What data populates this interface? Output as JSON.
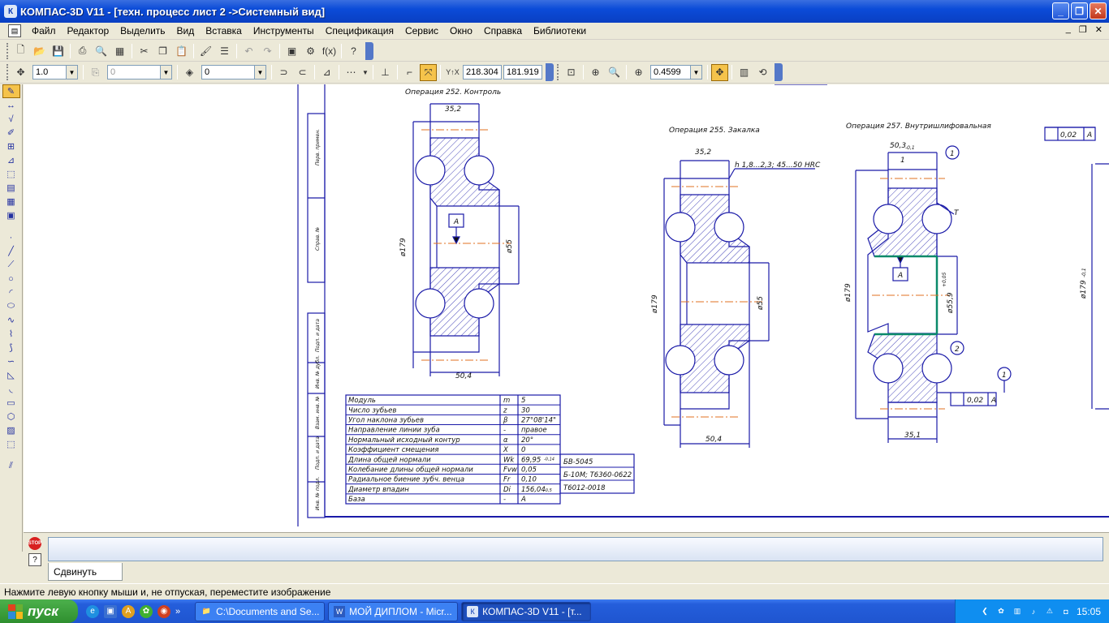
{
  "window": {
    "title": "КОМПАС-3D V11 - [техн. процесс лист 2 ->Системный вид]",
    "app_icon": "К"
  },
  "menu": [
    "Файл",
    "Редактор",
    "Выделить",
    "Вид",
    "Вставка",
    "Инструменты",
    "Спецификация",
    "Сервис",
    "Окно",
    "Справка",
    "Библиотеки"
  ],
  "toolbar2": {
    "line_weight": "1.0",
    "layer_state": "0",
    "layer": "0",
    "coord_x": "218.304",
    "coord_y": "181.919",
    "zoom": "0.4599"
  },
  "drawing": {
    "op252": "Операция 252. Контроль",
    "op255": "Операция 255. Закалка",
    "op257": "Операция 257. Внутришлифовальная",
    "dims": {
      "d352": "35,2",
      "d504": "50,4",
      "d179": "ø179",
      "d55": "ø55",
      "dA": "A",
      "d503": "50,3",
      "d503tol": "-0,1",
      "d351": "35,1",
      "d559": "ø55,9",
      "d559tol": "+0,05",
      "d179tol": "-0,1",
      "hrc": "h 1,8...2,3; 45...50  HRC",
      "tol002": "0,02",
      "t": "T",
      "n1": "1",
      "n2": "2",
      "n1b": "1"
    },
    "side_labels": [
      "Перв. примен.",
      "Справ. №",
      "Подп. и дата",
      "Инв. № дубл.",
      "Взам. инв. №",
      "Подп. и дата",
      "Инв. № подл."
    ],
    "table_rows": [
      {
        "name": "Модуль",
        "sym": "m",
        "val": "5"
      },
      {
        "name": "Число зубьев",
        "sym": "z",
        "val": "30"
      },
      {
        "name": "Угол наклона зубьев",
        "sym": "β",
        "val": "27°08'14\""
      },
      {
        "name": "Направление линии зуба",
        "sym": "-",
        "val": "правое"
      },
      {
        "name": "Нормальный исходный контур",
        "sym": "α",
        "val": "20°"
      },
      {
        "name": "Коэффициент смещения",
        "sym": "X",
        "val": "0"
      },
      {
        "name": "Длина общей нормали",
        "sym": "Wk",
        "val": "69,95"
      },
      {
        "name": "Колебание длины общей нормали",
        "sym": "Fvw",
        "val": "0,05"
      },
      {
        "name": "Радиальное биение зубч. венца",
        "sym": "Fr",
        "val": "0,10"
      },
      {
        "name": "Диаметр впадин",
        "sym": "Di",
        "val": "156,04"
      },
      {
        "name": "База",
        "sym": "-",
        "val": "A"
      }
    ],
    "wk_tol": "-0,14",
    "di_tol": "-0,5",
    "side_table": [
      "БВ-5045",
      "Б-10М; Т6360-0622",
      "Т6012-0018"
    ]
  },
  "command": {
    "tab": "Сдвинуть",
    "stop": "STOP",
    "help": "?"
  },
  "status": "Нажмите левую кнопку мыши и, не отпуская, переместите изображение",
  "taskbar": {
    "start": "пуск",
    "tasks": [
      "C:\\Documents and Se...",
      "МОЙ ДИПЛОМ - Micr...",
      "КОМПАС-3D V11 - [т..."
    ],
    "lang": "RU",
    "clock": "15:05"
  },
  "colors": {
    "title": "#0b4bd8",
    "drawing_line": "#1a1aa8",
    "axis": "#e07020",
    "hatch": "#1a1aa8",
    "green": "#0a8a6a"
  }
}
